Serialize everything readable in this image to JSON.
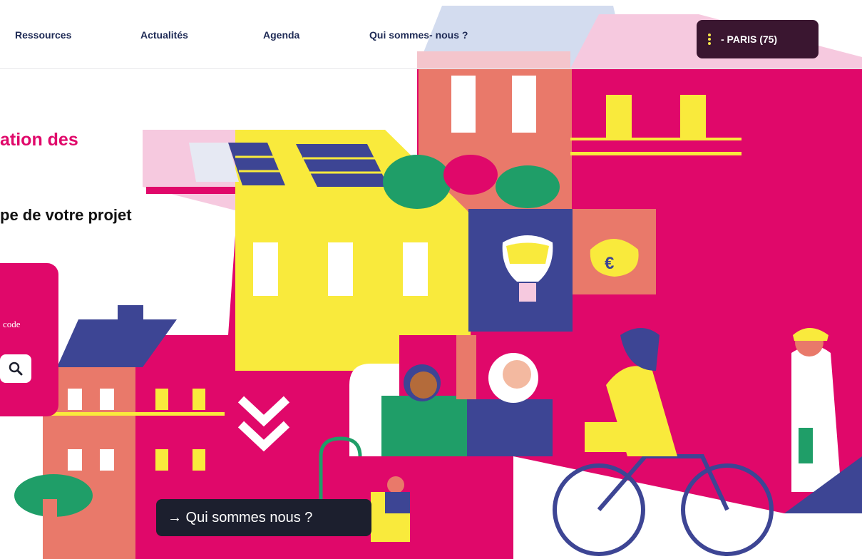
{
  "nav": {
    "items": [
      {
        "label": "Ressources"
      },
      {
        "label": "Actualités"
      },
      {
        "label": "Agenda"
      },
      {
        "label": "Qui sommes- nous ?"
      }
    ],
    "region_button": {
      "label": "- PARIS (75)"
    }
  },
  "hero": {
    "title_fragment": "ation des",
    "subtitle_fragment": "pe de votre projet"
  },
  "search": {
    "label_fragment": "code",
    "icon": "search-icon"
  },
  "cta": {
    "label": "→ Qui sommes nous ?"
  },
  "colors": {
    "magenta": "#e0086a",
    "yellow": "#f9ea3c",
    "navy": "#3d4594",
    "salmon": "#e9796a",
    "dark": "#1c1f2e",
    "green": "#1f9e68"
  }
}
